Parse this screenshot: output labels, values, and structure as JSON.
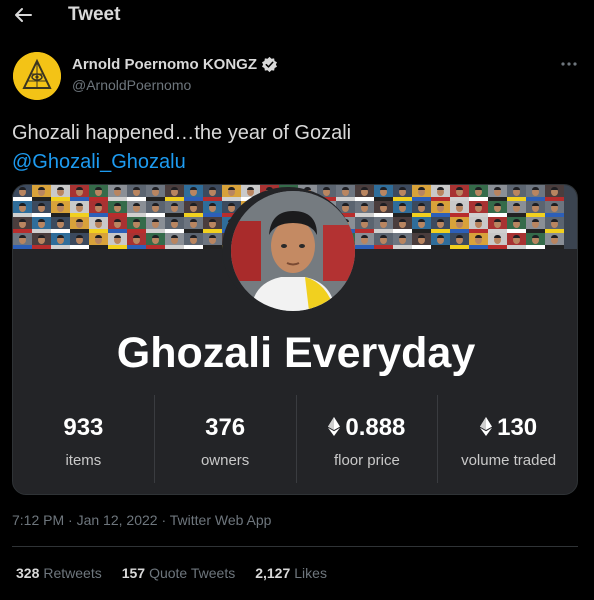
{
  "header": {
    "title": "Tweet",
    "back_icon": "arrow-left-icon"
  },
  "author": {
    "name": "Arnold Poernomo KONGZ",
    "handle": "@ArnoldPoernomo",
    "avatar_color": "#f3c316",
    "verified_icon": "verified-badge-icon",
    "more_icon": "more-dots-icon"
  },
  "tweet": {
    "text": "Ghozali happened…the year of Gozali",
    "mention": "@Ghozali_Ghozalu",
    "mention_color": "#1d9bf0"
  },
  "card": {
    "collection_title": "Ghozali Everyday",
    "stats": [
      {
        "value": "933",
        "label": "items",
        "eth": false
      },
      {
        "value": "376",
        "label": "owners",
        "eth": false
      },
      {
        "value": "0.888",
        "label": "floor price",
        "eth": true
      },
      {
        "value": "130",
        "label": "volume traded",
        "eth": true
      }
    ]
  },
  "meta": {
    "time": "7:12 PM",
    "date": "Jan 12, 2022",
    "source": "Twitter Web App",
    "separator": "·"
  },
  "engagement": [
    {
      "count": "328",
      "label": "Retweets"
    },
    {
      "count": "157",
      "label": "Quote Tweets"
    },
    {
      "count": "2,127",
      "label": "Likes"
    }
  ]
}
